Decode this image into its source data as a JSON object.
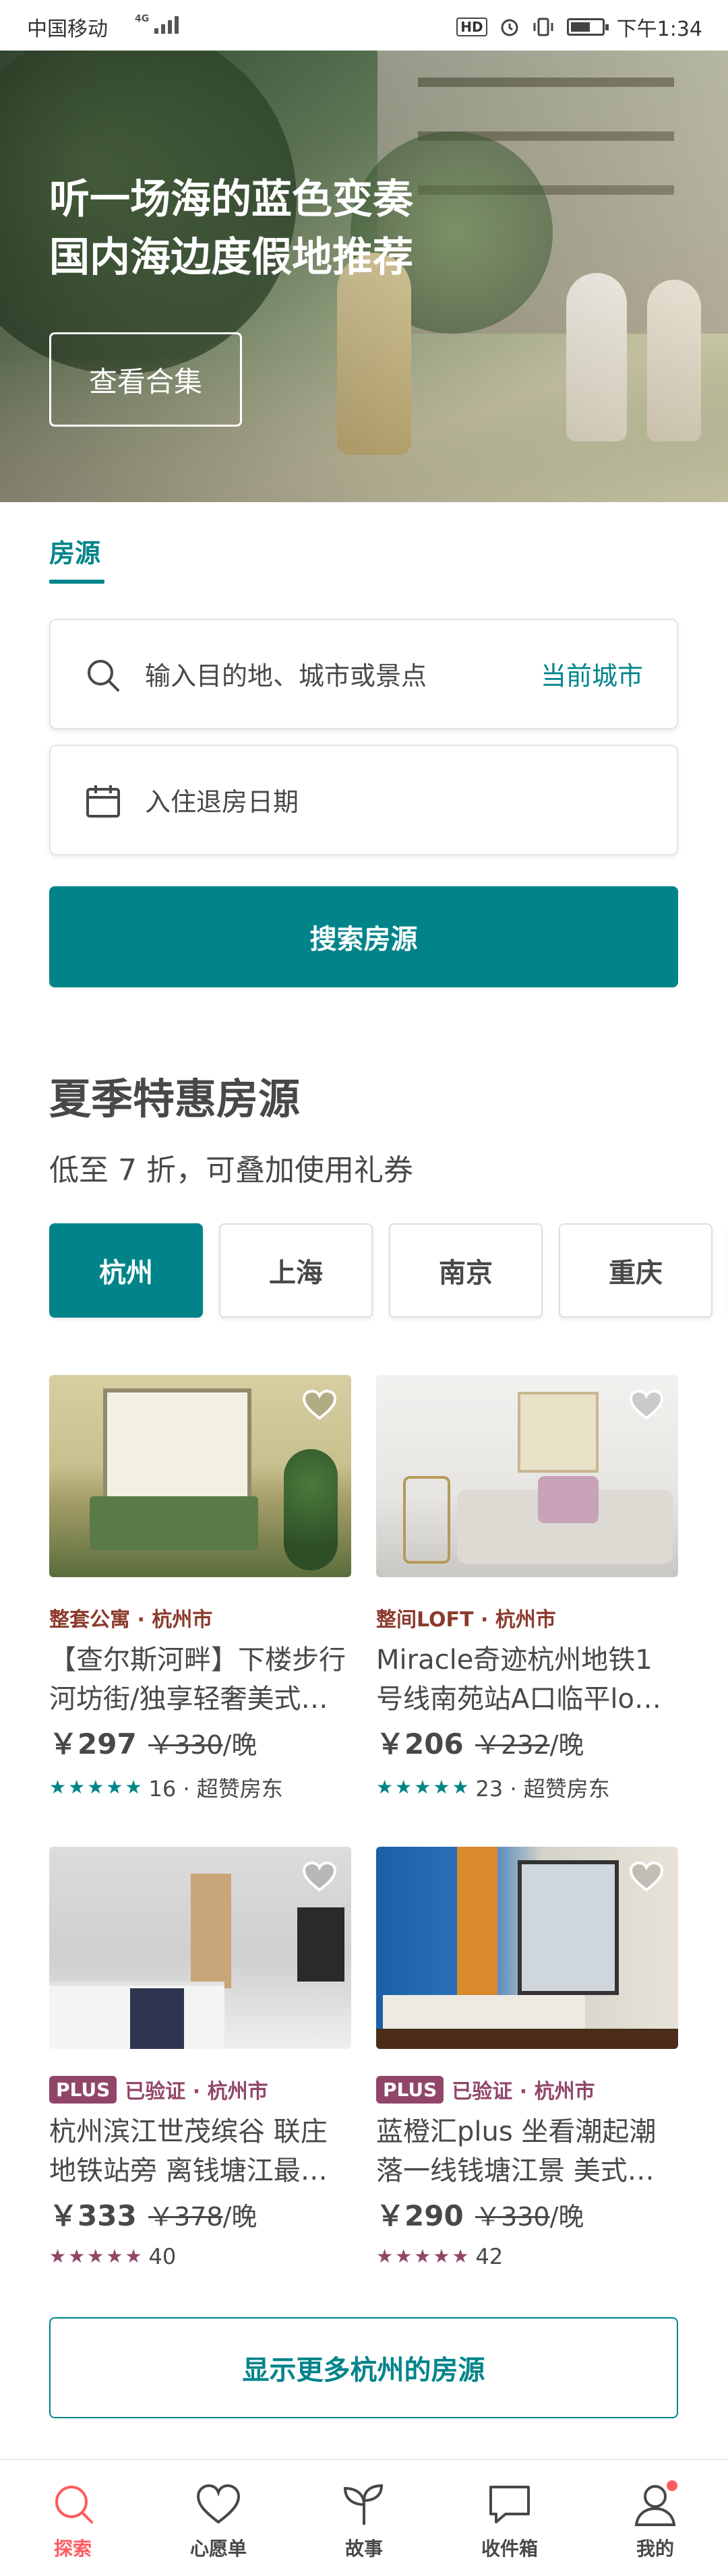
{
  "status_bar": {
    "carrier": "中国移动",
    "network": "4G",
    "hd": "HD",
    "time": "下午1:34"
  },
  "hero": {
    "title_line1": "听一场海的蓝色变奏",
    "title_line2": "国内海边度假地推荐",
    "button": "查看合集"
  },
  "section_tab": "房源",
  "search": {
    "placeholder": "输入目的地、城市或景点",
    "current_city": "当前城市",
    "date_label": "入住退房日期",
    "button": "搜索房源"
  },
  "promo": {
    "title": "夏季特惠房源",
    "subtitle": "低至 7 折，可叠加使用礼券",
    "cities": [
      "杭州",
      "上海",
      "南京",
      "重庆"
    ],
    "active_city": "杭州"
  },
  "listings": [
    {
      "badge": "",
      "meta": "整套公寓 · 杭州市",
      "title": "【查尔斯河畔】下楼步行河坊街/独享轻奢美式…",
      "price": "￥297",
      "old_price": "￥330",
      "unit": "/晚",
      "rating_text": "16 · 超赞房东",
      "star_color": "#00848a"
    },
    {
      "badge": "",
      "meta": "整间LOFT · 杭州市",
      "title": "Miracle奇迹杭州地铁1号线南苑站A口临平lo…",
      "price": "￥206",
      "old_price": "￥232",
      "unit": "/晚",
      "rating_text": "23 · 超赞房东",
      "star_color": "#00848a"
    },
    {
      "badge": "PLUS",
      "meta": "已验证 · 杭州市",
      "title": "杭州滨江世茂缤谷 联庄地铁站旁 离钱塘江最…",
      "price": "￥333",
      "old_price": "￥378",
      "unit": "/晚",
      "rating_text": "40",
      "star_color": "#914669"
    },
    {
      "badge": "PLUS",
      "meta": "已验证 · 杭州市",
      "title": "蓝橙汇plus 坐看潮起潮落一线钱塘江景 美式…",
      "price": "￥290",
      "old_price": "￥330",
      "unit": "/晚",
      "rating_text": "42",
      "star_color": "#914669"
    }
  ],
  "more_button": "显示更多杭州的房源",
  "nav": [
    {
      "label": "探索",
      "icon": "search-icon",
      "active": true
    },
    {
      "label": "心愿单",
      "icon": "heart-icon",
      "active": false
    },
    {
      "label": "故事",
      "icon": "sprout-icon",
      "active": false
    },
    {
      "label": "收件箱",
      "icon": "chat-icon",
      "active": false
    },
    {
      "label": "我的",
      "icon": "profile-icon",
      "active": false
    }
  ],
  "colors": {
    "brand": "#00848a",
    "plus": "#914669",
    "active_nav": "#ff5a5f"
  }
}
